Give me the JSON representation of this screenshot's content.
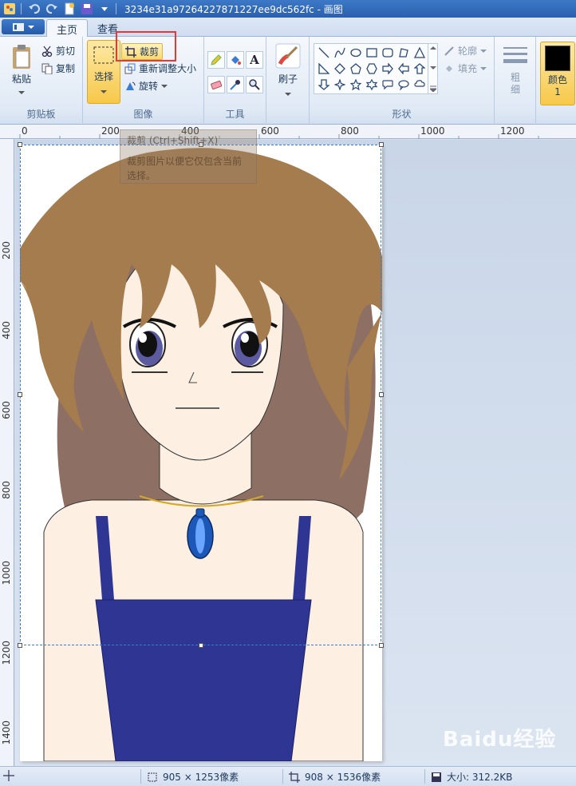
{
  "window": {
    "title": "3234e31a97264227871227ee9dc562fc - 画图"
  },
  "tabs": [
    {
      "label": "主页",
      "active": true
    },
    {
      "label": "查看",
      "active": false
    }
  ],
  "ribbon": {
    "clipboard": {
      "group_label": "剪贴板",
      "paste": "粘贴",
      "cut": "剪切",
      "copy": "复制"
    },
    "image": {
      "group_label": "图像",
      "select": "选择",
      "crop": "裁剪",
      "resize": "重新调整大小",
      "rotate": "旋转"
    },
    "tools": {
      "group_label": "工具"
    },
    "brushes": {
      "label": "刷子"
    },
    "shapes": {
      "group_label": "形状",
      "outline": "轮廓",
      "fill": "填充"
    },
    "size": {
      "label": "粗细"
    },
    "colors": {
      "color1_label": "颜色 1",
      "color1": "#000000"
    }
  },
  "tooltip": {
    "title": "裁剪 (Ctrl+Shift+X)",
    "body": "裁剪图片以便它仅包含当前选择。"
  },
  "ruler": {
    "h_labels": [
      "0",
      "200",
      "400",
      "600",
      "800",
      "1000",
      "1200"
    ],
    "v_labels": [
      "200",
      "400",
      "600",
      "800",
      "1000",
      "1200",
      "1400"
    ]
  },
  "status": {
    "selection_size": "905 × 1253像素",
    "image_size": "908 × 1536像素",
    "file_size": "大小: 312.2KB"
  },
  "watermark": {
    "text": "Baidu经验"
  },
  "colors": {
    "accent_highlight": "#f7c84a",
    "crop_callout": "#e53935",
    "hair": "#a57c4e",
    "dress": "#2e3592"
  }
}
